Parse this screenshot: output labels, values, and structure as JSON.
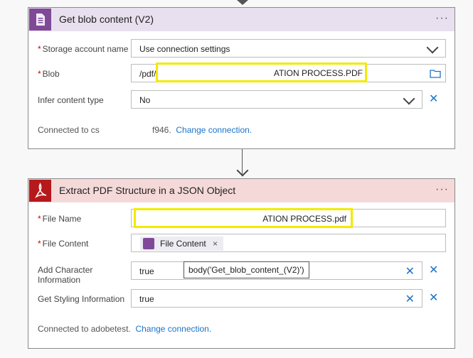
{
  "card1": {
    "title": "Get blob content (V2)",
    "more": "···",
    "fields": {
      "storage": {
        "label": "Storage account name",
        "value": "Use connection settings"
      },
      "blob": {
        "label": "Blob",
        "value_prefix": "/pdf/",
        "value_suffix": "ATION PROCESS.PDF"
      },
      "infer": {
        "label": "Infer content type",
        "value": "No"
      }
    },
    "footer": {
      "prefix": "Connected to cs",
      "suffix": "f946.",
      "link": "Change connection."
    }
  },
  "card2": {
    "title": "Extract PDF Structure in a JSON Object",
    "more": "···",
    "fields": {
      "filename": {
        "label": "File Name",
        "value_suffix": "ATION PROCESS.pdf"
      },
      "filecontent": {
        "label": "File Content",
        "token": "File Content"
      },
      "addchar": {
        "label": "Add Character Information",
        "value": "true"
      },
      "styling": {
        "label": "Get Styling Information",
        "value": "true"
      }
    },
    "footer": {
      "prefix": "Connected to adobetest.",
      "link": "Change connection."
    }
  },
  "tooltip": "body('Get_blob_content_(V2)')",
  "colors": {
    "blob_purple": "#804998",
    "adobe_red": "#b6191c",
    "link_blue": "#1c73c8",
    "highlight": "#f2ea00"
  }
}
